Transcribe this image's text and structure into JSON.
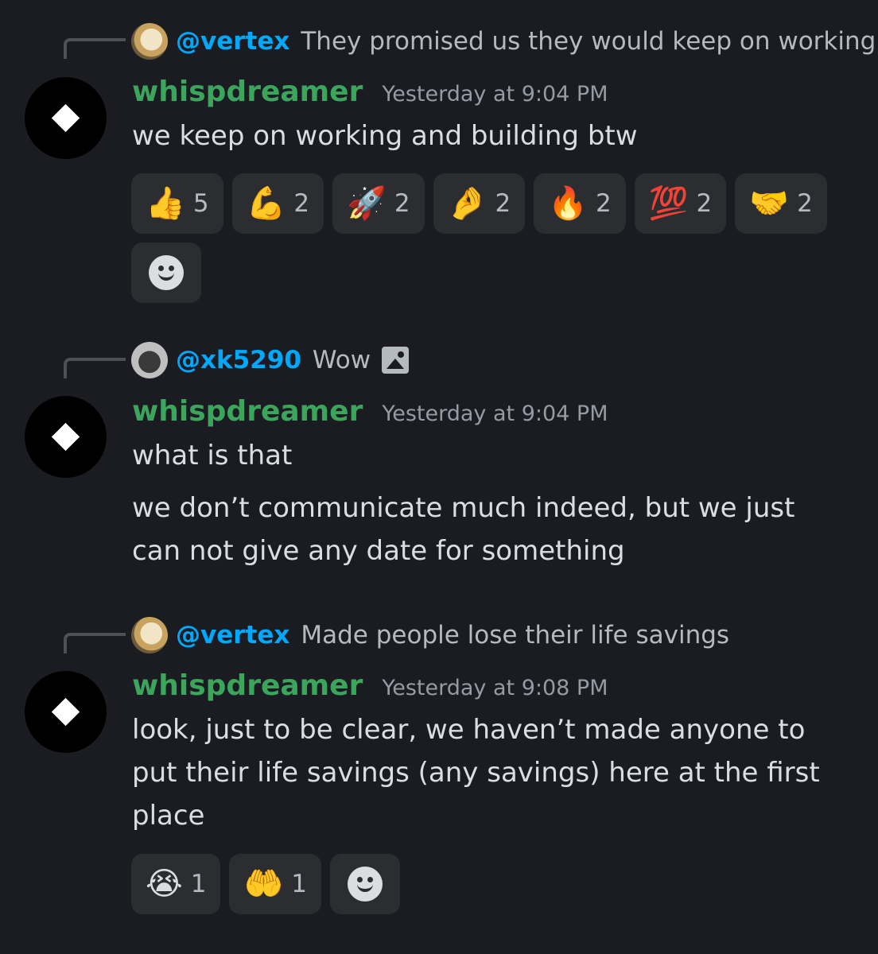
{
  "messages": [
    {
      "reply": {
        "author": "@vertex",
        "text": "They promised us they would keep on working"
      },
      "username": "whispdreamer",
      "timestamp": "Yesterday at 9:04 PM",
      "paragraphs": [
        "we keep on working and building btw"
      ],
      "reactions": [
        {
          "emoji": "👍",
          "name": "thumbs-up-icon",
          "count": "5"
        },
        {
          "emoji": "💪",
          "name": "flexed-biceps-icon",
          "count": "2"
        },
        {
          "emoji": "🚀",
          "name": "rocket-icon",
          "count": "2"
        },
        {
          "emoji": "🤌",
          "name": "pinched-fingers-icon",
          "count": "2"
        },
        {
          "emoji": "🔥",
          "name": "fire-icon",
          "count": "2"
        },
        {
          "emoji": "💯",
          "name": "hundred-points-icon",
          "count": "2"
        },
        {
          "emoji": "🤝",
          "name": "handshake-icon",
          "count": "2"
        }
      ]
    },
    {
      "reply": {
        "author": "@xk5290",
        "text": "Wow",
        "has_image": true
      },
      "username": "whispdreamer",
      "timestamp": "Yesterday at 9:04 PM",
      "paragraphs": [
        "what is that",
        "we don’t communicate much indeed, but we just can not give any date for something"
      ]
    },
    {
      "reply": {
        "author": "@vertex",
        "text": "Made people lose their life savings"
      },
      "username": "whispdreamer",
      "timestamp": "Yesterday at 9:08 PM",
      "paragraphs": [
        "look, just to be clear, we haven’t made anyone to put their life savings (any savings) here at the first place"
      ],
      "reactions": [
        {
          "emoji": "😭",
          "name": "loudly-crying-face-icon",
          "count": "1"
        },
        {
          "emoji": "🤲",
          "name": "palms-up-diamond-icon",
          "count": "1"
        }
      ]
    }
  ]
}
